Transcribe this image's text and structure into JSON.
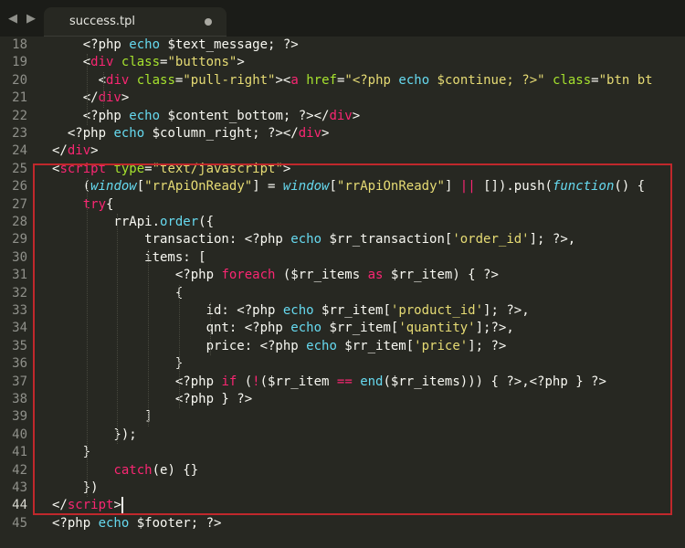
{
  "tab": {
    "filename": "success.tpl"
  },
  "nav": {
    "back_icon": "◀",
    "forward_icon": "▶"
  },
  "colors": {
    "background": "#272822",
    "highlight_border": "#c0282c",
    "tag": "#f92672",
    "attribute": "#a6e22e",
    "string": "#e6db74",
    "keyword": "#66d9ef"
  },
  "lines": [
    {
      "n": "18",
      "tokens": [
        [
          "p",
          "    <?php "
        ],
        [
          "e",
          "echo"
        ],
        [
          "p",
          " $text_message; ?>"
        ]
      ]
    },
    {
      "n": "19",
      "tokens": [
        [
          "p",
          "    <"
        ],
        [
          "t",
          "div"
        ],
        [
          "p",
          " "
        ],
        [
          "a",
          "class"
        ],
        [
          "p",
          "="
        ],
        [
          "s",
          "\"buttons\""
        ],
        [
          "p",
          ">"
        ]
      ]
    },
    {
      "n": "20",
      "tokens": [
        [
          "p",
          "      <"
        ],
        [
          "t",
          "div"
        ],
        [
          "p",
          " "
        ],
        [
          "a",
          "class"
        ],
        [
          "p",
          "="
        ],
        [
          "s",
          "\"pull-right\""
        ],
        [
          "p",
          "><"
        ],
        [
          "t",
          "a"
        ],
        [
          "p",
          " "
        ],
        [
          "a",
          "href"
        ],
        [
          "p",
          "="
        ],
        [
          "s",
          "\"<?php "
        ],
        [
          "e",
          "echo"
        ],
        [
          "s",
          " $continue; ?>\""
        ],
        [
          "p",
          " "
        ],
        [
          "a",
          "class"
        ],
        [
          "p",
          "="
        ],
        [
          "s",
          "\"btn bt"
        ]
      ]
    },
    {
      "n": "21",
      "tokens": [
        [
          "p",
          "    </"
        ],
        [
          "t",
          "div"
        ],
        [
          "p",
          ">"
        ]
      ]
    },
    {
      "n": "22",
      "tokens": [
        [
          "p",
          "    <?php "
        ],
        [
          "e",
          "echo"
        ],
        [
          "p",
          " $content_bottom; ?></"
        ],
        [
          "t",
          "div"
        ],
        [
          "p",
          ">"
        ]
      ]
    },
    {
      "n": "23",
      "tokens": [
        [
          "p",
          "  <?php "
        ],
        [
          "e",
          "echo"
        ],
        [
          "p",
          " $column_right; ?></"
        ],
        [
          "t",
          "div"
        ],
        [
          "p",
          ">"
        ]
      ]
    },
    {
      "n": "24",
      "tokens": [
        [
          "p",
          "</"
        ],
        [
          "t",
          "div"
        ],
        [
          "p",
          ">"
        ]
      ]
    },
    {
      "n": "25",
      "tokens": [
        [
          "p",
          "<"
        ],
        [
          "t",
          "script"
        ],
        [
          "p",
          " "
        ],
        [
          "a",
          "type"
        ],
        [
          "p",
          "="
        ],
        [
          "s",
          "\"text/javascript\""
        ],
        [
          "p",
          ">"
        ]
      ]
    },
    {
      "n": "26",
      "tokens": [
        [
          "p",
          "    ("
        ],
        [
          "i",
          "window"
        ],
        [
          "p",
          "["
        ],
        [
          "s",
          "\"rrApiOnReady\""
        ],
        [
          "p",
          "] = "
        ],
        [
          "i",
          "window"
        ],
        [
          "p",
          "["
        ],
        [
          "s",
          "\"rrApiOnReady\""
        ],
        [
          "p",
          "] "
        ],
        [
          "t",
          "||"
        ],
        [
          "p",
          " []).push("
        ],
        [
          "i",
          "function"
        ],
        [
          "p",
          "() {"
        ]
      ]
    },
    {
      "n": "27",
      "tokens": [
        [
          "p",
          "    "
        ],
        [
          "t",
          "try"
        ],
        [
          "p",
          "{"
        ]
      ]
    },
    {
      "n": "28",
      "tokens": [
        [
          "p",
          "        rrApi."
        ],
        [
          "e",
          "order"
        ],
        [
          "p",
          "({"
        ]
      ]
    },
    {
      "n": "29",
      "tokens": [
        [
          "p",
          "            transaction: <?php "
        ],
        [
          "e",
          "echo"
        ],
        [
          "p",
          " $rr_transaction["
        ],
        [
          "s",
          "'order_id'"
        ],
        [
          "p",
          "]; ?>,"
        ]
      ]
    },
    {
      "n": "30",
      "tokens": [
        [
          "p",
          "            items: ["
        ]
      ]
    },
    {
      "n": "31",
      "tokens": [
        [
          "p",
          "                <?php "
        ],
        [
          "t",
          "foreach"
        ],
        [
          "p",
          " ($rr_items "
        ],
        [
          "t",
          "as"
        ],
        [
          "p",
          " $rr_item) { ?>"
        ]
      ]
    },
    {
      "n": "32",
      "tokens": [
        [
          "p",
          "                {"
        ]
      ]
    },
    {
      "n": "33",
      "tokens": [
        [
          "p",
          "                    id: <?php "
        ],
        [
          "e",
          "echo"
        ],
        [
          "p",
          " $rr_item["
        ],
        [
          "s",
          "'product_id'"
        ],
        [
          "p",
          "]; ?>,"
        ]
      ]
    },
    {
      "n": "34",
      "tokens": [
        [
          "p",
          "                    qnt: <?php "
        ],
        [
          "e",
          "echo"
        ],
        [
          "p",
          " $rr_item["
        ],
        [
          "s",
          "'quantity'"
        ],
        [
          "p",
          "];?>,"
        ]
      ]
    },
    {
      "n": "35",
      "tokens": [
        [
          "p",
          "                    price: <?php "
        ],
        [
          "e",
          "echo"
        ],
        [
          "p",
          " $rr_item["
        ],
        [
          "s",
          "'price'"
        ],
        [
          "p",
          "]; ?>"
        ]
      ]
    },
    {
      "n": "36",
      "tokens": [
        [
          "p",
          "                }"
        ]
      ]
    },
    {
      "n": "37",
      "tokens": [
        [
          "p",
          "                <?php "
        ],
        [
          "t",
          "if"
        ],
        [
          "p",
          " ("
        ],
        [
          "t",
          "!"
        ],
        [
          "p",
          "($rr_item "
        ],
        [
          "t",
          "=="
        ],
        [
          "p",
          " "
        ],
        [
          "e",
          "end"
        ],
        [
          "p",
          "($rr_items))) { ?>,<?php } ?>"
        ]
      ]
    },
    {
      "n": "38",
      "tokens": [
        [
          "p",
          "                <?php } ?>"
        ]
      ]
    },
    {
      "n": "39",
      "tokens": [
        [
          "p",
          "            ]"
        ]
      ]
    },
    {
      "n": "40",
      "tokens": [
        [
          "p",
          "        });"
        ]
      ]
    },
    {
      "n": "41",
      "tokens": [
        [
          "p",
          "    }"
        ]
      ]
    },
    {
      "n": "42",
      "tokens": [
        [
          "p",
          "        "
        ],
        [
          "t",
          "catch"
        ],
        [
          "p",
          "(e) {}"
        ]
      ]
    },
    {
      "n": "43",
      "tokens": [
        [
          "p",
          "    })"
        ]
      ]
    },
    {
      "n": "44",
      "tokens": [
        [
          "p",
          "</"
        ],
        [
          "t",
          "script"
        ],
        [
          "p",
          ">"
        ]
      ]
    },
    {
      "n": "45",
      "tokens": [
        [
          "p",
          "<?php "
        ],
        [
          "e",
          "echo"
        ],
        [
          "p",
          " $footer; ?>"
        ]
      ]
    }
  ]
}
